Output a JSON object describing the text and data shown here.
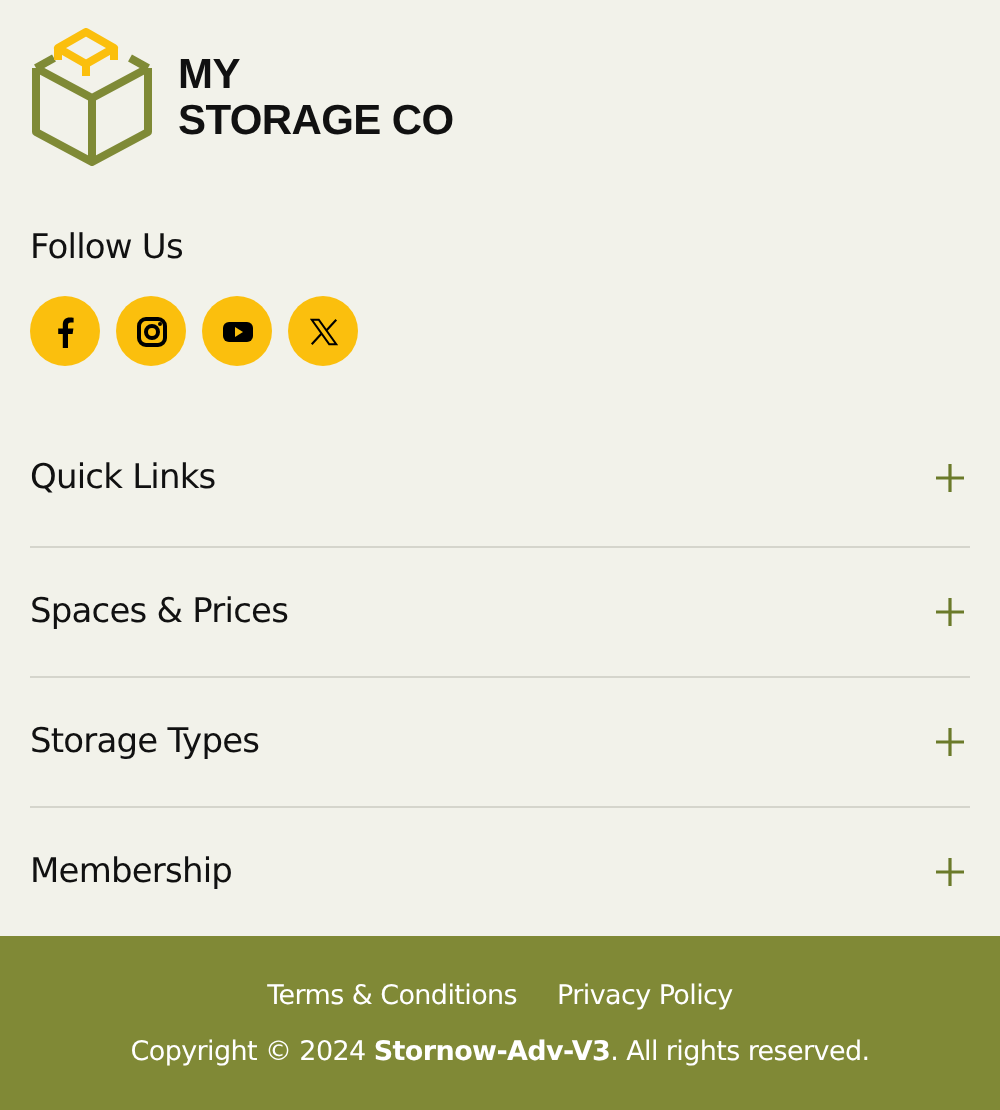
{
  "logo": {
    "lines": [
      "MY",
      "STORAGE CO"
    ]
  },
  "follow": {
    "title": "Follow Us",
    "socials": [
      {
        "kind": "facebook"
      },
      {
        "kind": "instagram"
      },
      {
        "kind": "youtube"
      },
      {
        "kind": "x"
      }
    ]
  },
  "sections": [
    {
      "title": "Quick Links",
      "expanded": false
    },
    {
      "title": "Spaces & Prices",
      "expanded": false
    },
    {
      "title": "Storage Types",
      "expanded": false
    },
    {
      "title": "Membership",
      "expanded": false
    }
  ],
  "footer": {
    "links": [
      "Terms & Conditions",
      "Privacy Policy"
    ],
    "copyright": "Copyright © 2024 **Stornow-Adv-V3**. All rights reserved."
  }
}
